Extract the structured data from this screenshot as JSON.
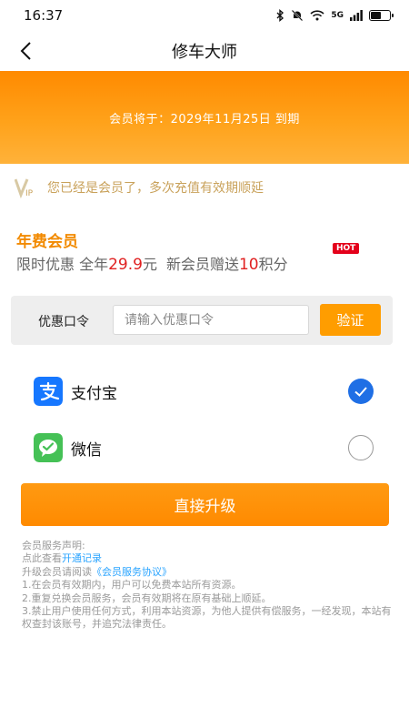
{
  "status_bar": {
    "time": "16:37",
    "network": "5G",
    "icons": [
      "bluetooth-icon",
      "mute-bell-icon",
      "wifi-icon",
      "signal-icon",
      "battery-icon"
    ],
    "battery_level": 0.5
  },
  "nav": {
    "title": "修车大师",
    "back_icon": "chevron-left-icon"
  },
  "banner": {
    "expire_text": "会员将于：2029年11月25日 到期"
  },
  "vip_notice": {
    "badge": "VIP",
    "message": "您已经是会员了，多次充值有效期顺延"
  },
  "plan": {
    "title": "年费会员",
    "desc_prefix": "限时优惠 全年",
    "price": "29.9",
    "price_unit": "元",
    "bonus_prefix": "新会员赠送",
    "bonus_points": "10",
    "bonus_suffix": "积分",
    "hot_badge": "HOT"
  },
  "coupon": {
    "label": "优惠口令",
    "placeholder": "请输入优惠口令",
    "value": "",
    "verify_label": "验证"
  },
  "payment": {
    "options": [
      {
        "label": "支付宝",
        "icon": "alipay-icon",
        "selected": true
      },
      {
        "label": "微信",
        "icon": "wechat-icon",
        "selected": false
      }
    ]
  },
  "upgrade_button": "直接升级",
  "notes": {
    "line1": "会员服务声明:",
    "line2_prefix": "点此查看",
    "line2_link": "开通记录",
    "line3_prefix": "升级会员请阅读",
    "line3_link": "《会员服务协议》",
    "item1": "1.在会员有效期内，用户可以免费本站所有资源。",
    "item2": "2.重复兑换会员服务，会员有效期将在原有基础上顺延。",
    "item3": "3.禁止用户使用任何方式，利用本站资源，为他人提供有偿服务，一经发现，本站有权查封该账号，并追究法律责任。"
  },
  "colors": {
    "accent_orange": "#ff8a00",
    "price_red": "#e02020",
    "vip_gold": "#c9a25b",
    "link_blue": "#2aa4ff",
    "check_blue": "#1f6fe5",
    "alipay_blue": "#1677ff",
    "wechat_green": "#45c156"
  }
}
